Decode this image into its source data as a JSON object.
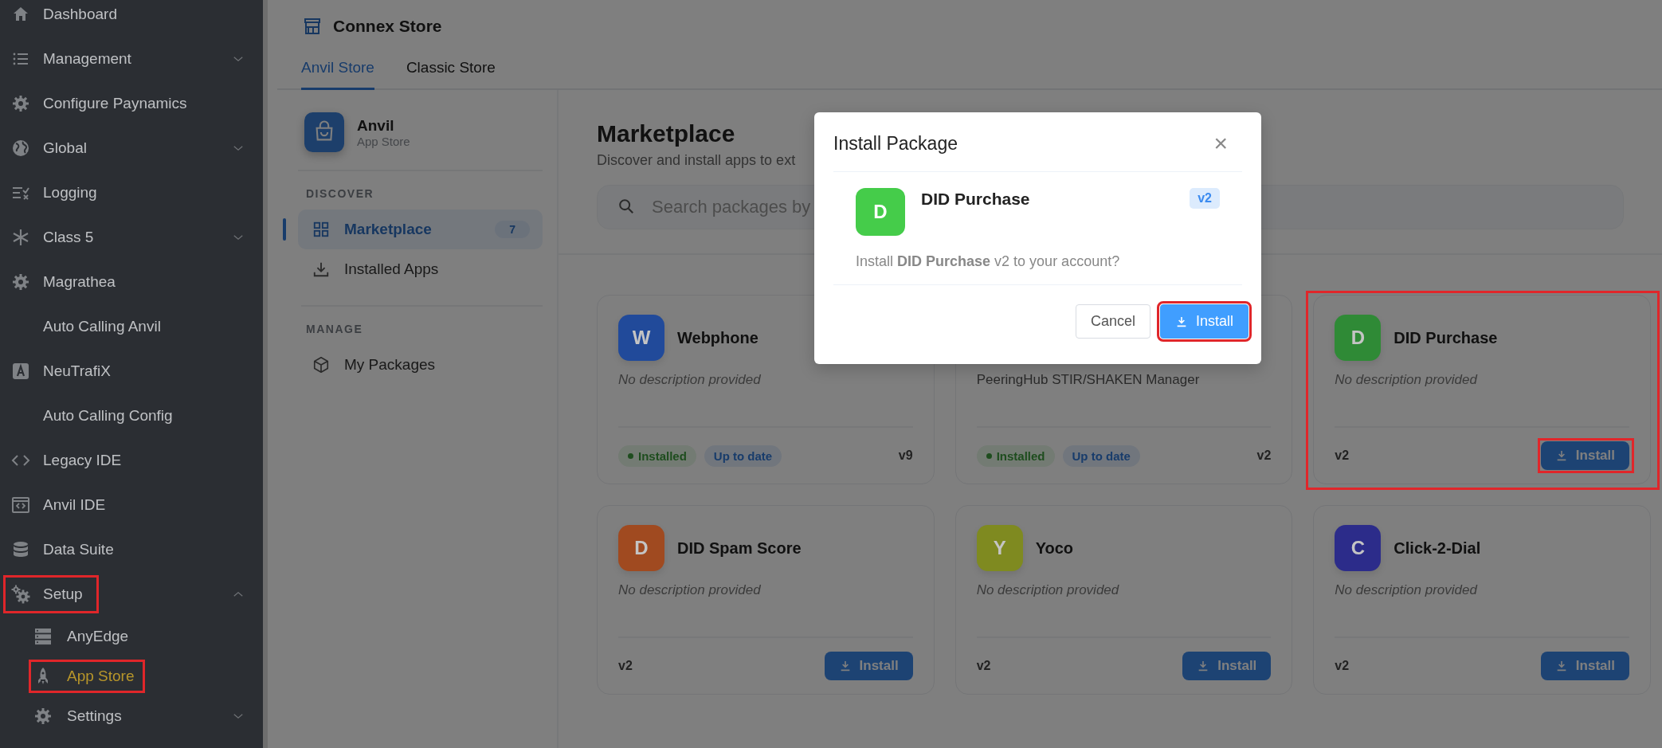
{
  "sidebar": {
    "items": [
      {
        "label": "Dashboard",
        "selected": false
      },
      {
        "label": "Management",
        "selected": false,
        "expanded": false
      },
      {
        "label": "Configure Paynamics",
        "selected": false
      },
      {
        "label": "Global",
        "selected": false,
        "expanded": false
      },
      {
        "label": "Logging",
        "selected": false
      },
      {
        "label": "Class 5",
        "selected": false,
        "expanded": false
      },
      {
        "label": "Magrathea",
        "selected": false
      },
      {
        "label": "Auto Calling Anvil",
        "selected": false
      },
      {
        "label": "NeuTrafiX",
        "selected": false
      },
      {
        "label": "Auto Calling Config",
        "selected": false
      },
      {
        "label": "Legacy IDE",
        "selected": false
      },
      {
        "label": "Anvil IDE",
        "selected": false
      },
      {
        "label": "Data Suite",
        "selected": false
      },
      {
        "label": "Setup",
        "selected": false,
        "expanded": true,
        "highlighted": true,
        "children": [
          {
            "label": "AnyEdge",
            "selected": false
          },
          {
            "label": "App Store",
            "selected": true,
            "highlighted": true
          },
          {
            "label": "Settings",
            "selected": false,
            "expanded": false
          }
        ]
      }
    ]
  },
  "header": {
    "title": "Connex Store"
  },
  "tabs": [
    {
      "label": "Anvil Store",
      "selected": true
    },
    {
      "label": "Classic Store",
      "selected": false
    }
  ],
  "store_panel": {
    "brand": "Anvil",
    "subtitle": "App Store",
    "sections": [
      {
        "heading": "DISCOVER",
        "items": [
          {
            "label": "Marketplace",
            "selected": true,
            "count": "7"
          },
          {
            "label": "Installed Apps",
            "selected": false
          }
        ]
      },
      {
        "heading": "MANAGE",
        "items": [
          {
            "label": "My Packages",
            "selected": false
          }
        ]
      }
    ]
  },
  "marketplace": {
    "title": "Marketplace",
    "subtitle": "Discover and install apps to ext",
    "search": {
      "placeholder": "Search packages by"
    },
    "cards": [
      {
        "kind": "installed",
        "letter": "W",
        "color": "#214a9a",
        "name": "Webphone",
        "description": "No description provided",
        "badges": [
          "Installed",
          "Up to date"
        ],
        "version": "v9"
      },
      {
        "kind": "installed",
        "description": "PeeringHub STIR/SHAKEN Manager",
        "badges": [
          "Installed",
          "Up to date"
        ],
        "version": "v2"
      },
      {
        "kind": "available",
        "letter": "D",
        "color": "#2f8a36",
        "name": "DID Purchase",
        "description": "No description provided",
        "version": "v2",
        "button": "Install",
        "highlighted": true
      },
      {
        "kind": "available",
        "letter": "D",
        "color": "#a04a20",
        "name": "DID Spam Score",
        "description": "No description provided",
        "version": "v2",
        "button": "Install",
        "highlighted": false
      },
      {
        "kind": "available",
        "letter": "Y",
        "color": "#7f8a20",
        "name": "Yoco",
        "description": "No description provided",
        "version": "v2",
        "button": "Install",
        "highlighted": false
      },
      {
        "kind": "available",
        "letter": "C",
        "color": "#2c2c8a",
        "name": "Click-2-Dial",
        "description": "No description provided",
        "version": "v2",
        "button": "Install",
        "highlighted": false
      }
    ]
  },
  "dialog": {
    "title": "Install Package",
    "close": "×",
    "letter": "D",
    "color": "#45cc4a",
    "name": "DID Purchase",
    "version": "v2",
    "message": "Install **DID Purchase** v2 to your account?",
    "buttons": [
      {
        "label": "Cancel",
        "kind": "secondary",
        "highlighted": false
      },
      {
        "label": "Install",
        "kind": "primary",
        "highlighted": true
      }
    ]
  }
}
